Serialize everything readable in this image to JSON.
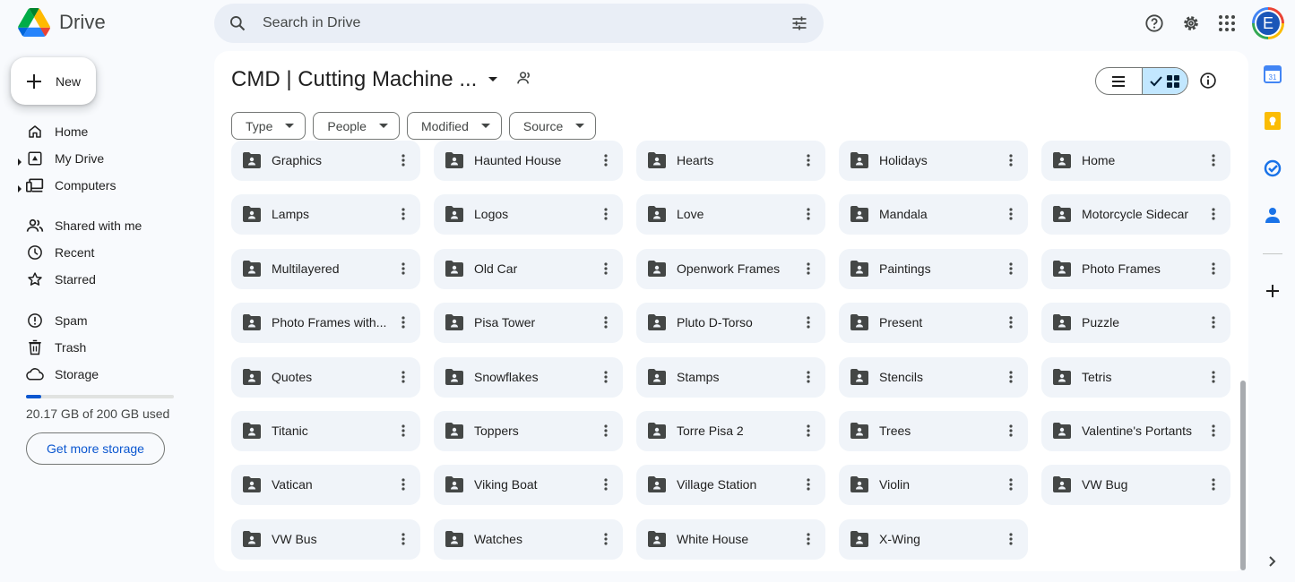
{
  "app": {
    "name": "Drive"
  },
  "search": {
    "placeholder": "Search in Drive"
  },
  "account": {
    "initial": "E"
  },
  "sidebar": {
    "new_label": "New",
    "items": [
      {
        "label": "Home",
        "icon": "home-icon"
      },
      {
        "label": "My Drive",
        "icon": "my-drive-icon"
      },
      {
        "label": "Computers",
        "icon": "computers-icon"
      },
      {
        "label": "Shared with me",
        "icon": "shared-icon"
      },
      {
        "label": "Recent",
        "icon": "clock-icon"
      },
      {
        "label": "Starred",
        "icon": "star-icon"
      },
      {
        "label": "Spam",
        "icon": "spam-icon"
      },
      {
        "label": "Trash",
        "icon": "trash-icon"
      },
      {
        "label": "Storage",
        "icon": "cloud-icon"
      }
    ],
    "storage": {
      "used_text": "20.17 GB of 200 GB used",
      "used_fraction": 0.1,
      "button_label": "Get more storage"
    }
  },
  "main": {
    "title": "CMD | Cutting Machine ...",
    "filters": [
      "Type",
      "People",
      "Modified",
      "Source"
    ],
    "folders": [
      "Graphics",
      "Haunted House",
      "Hearts",
      "Holidays",
      "Home",
      "Lamps",
      "Logos",
      "Love",
      "Mandala",
      "Motorcycle Sidecar",
      "Multilayered",
      "Old Car",
      "Openwork Frames",
      "Paintings",
      "Photo Frames",
      "Photo Frames with...",
      "Pisa Tower",
      "Pluto D-Torso",
      "Present",
      "Puzzle",
      "Quotes",
      "Snowflakes",
      "Stamps",
      "Stencils",
      "Tetris",
      "Titanic",
      "Toppers",
      "Torre Pisa 2",
      "Trees",
      "Valentine's Portants",
      "Vatican",
      "Viking Boat",
      "Village Station",
      "Violin",
      "VW Bug",
      "VW Bus",
      "Watches",
      "White House",
      "X-Wing"
    ]
  },
  "colors": {
    "accent": "#0b57d0",
    "folder_bg": "#f0f4f9",
    "page_bg": "#f8fafd"
  }
}
